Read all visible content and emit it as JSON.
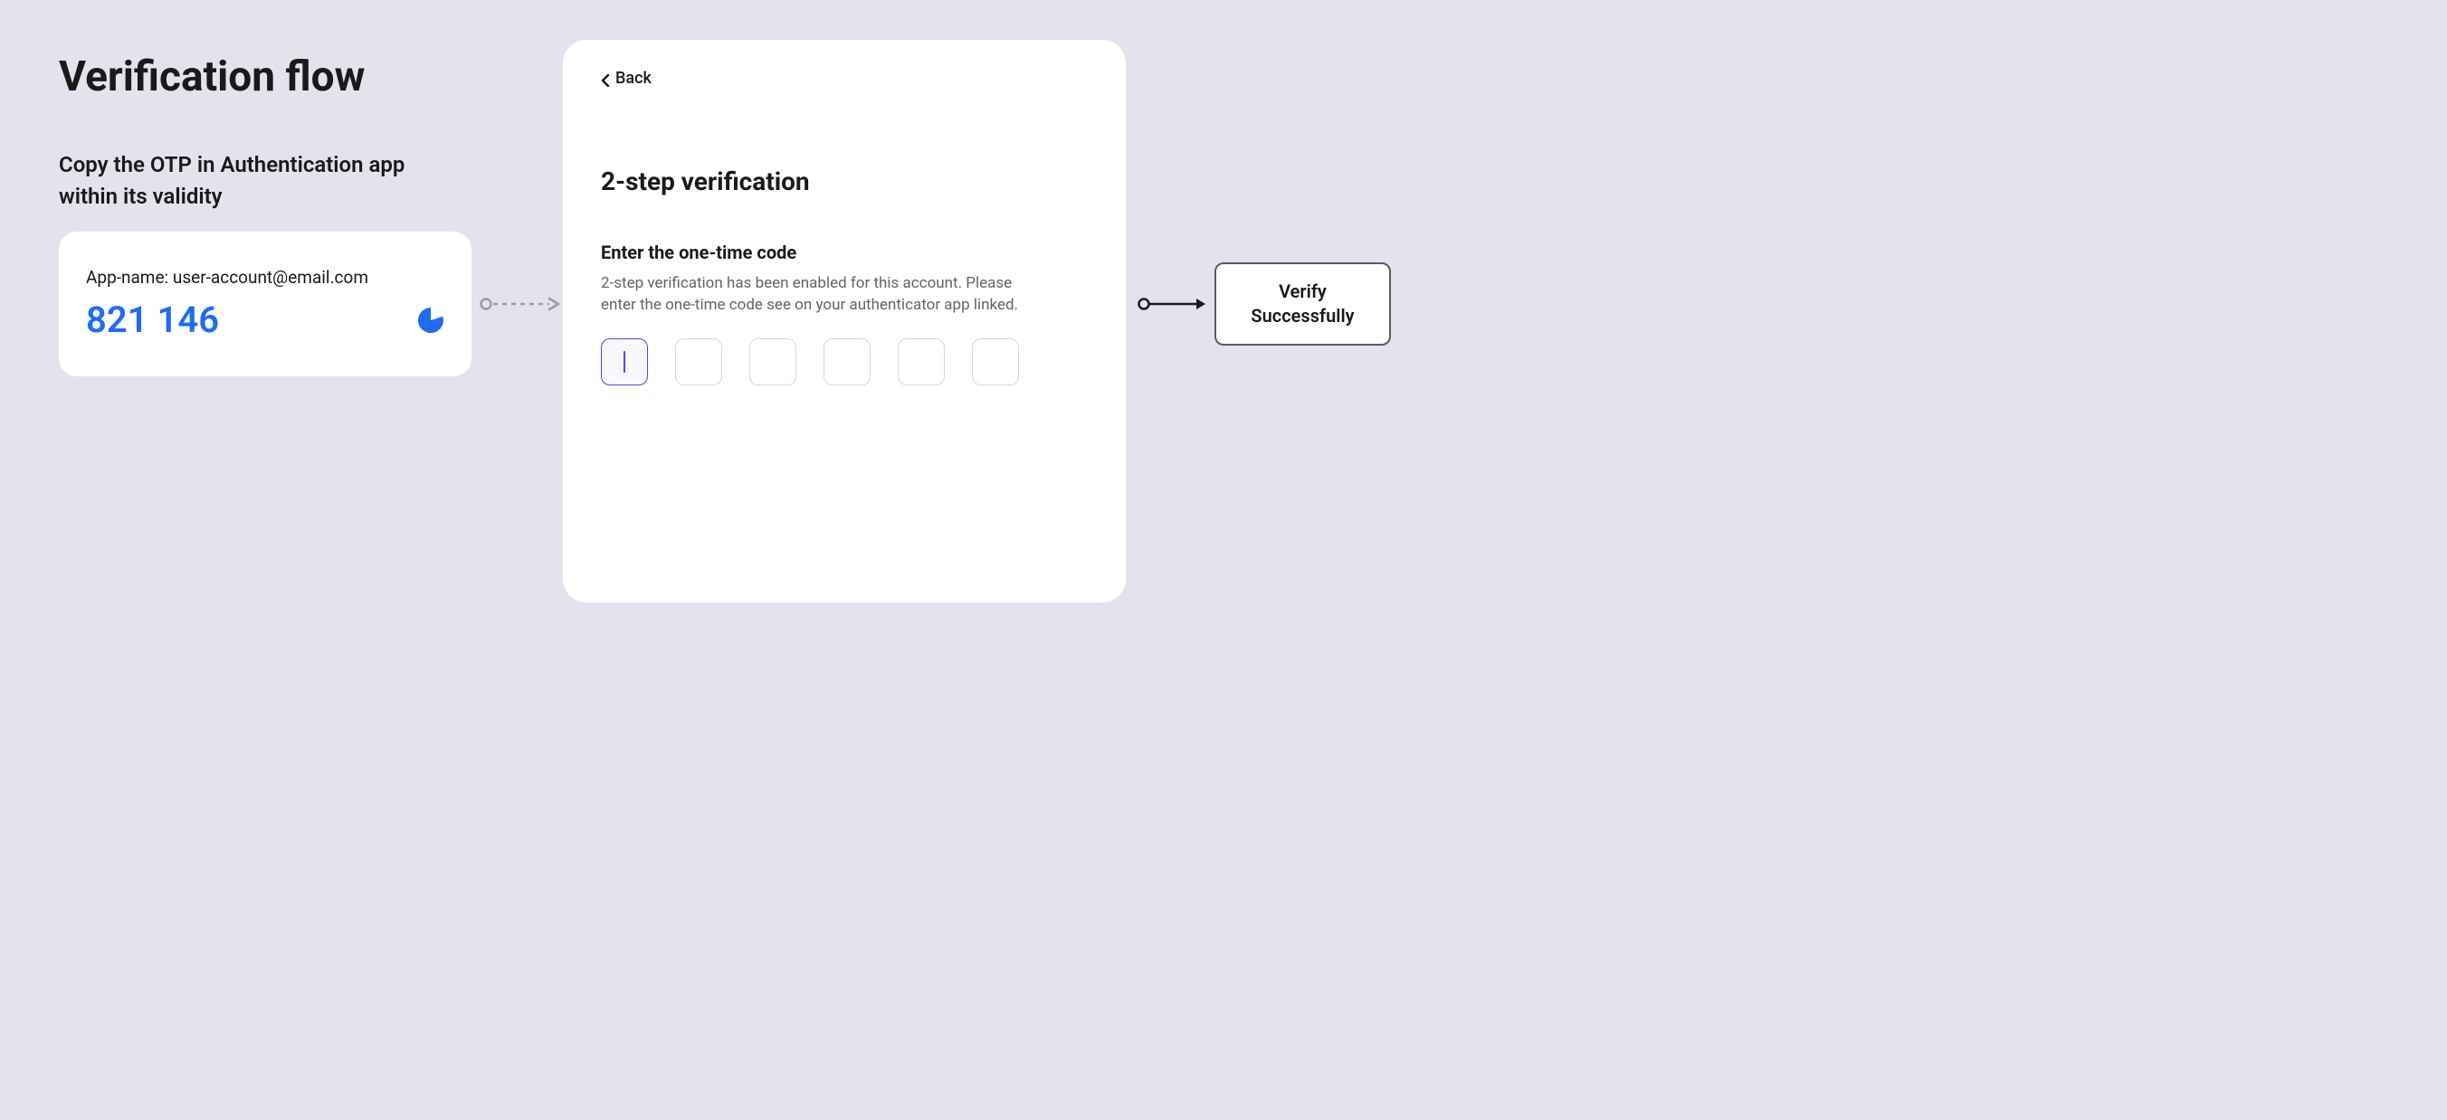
{
  "title": "Verification flow",
  "step_caption": "Copy the OTP in Authentication app within its validity",
  "otp": {
    "account_label": "App-name: user-account@email.com",
    "code": "821 146"
  },
  "card": {
    "back_label": "Back",
    "heading": "2-step verification",
    "subheading": "Enter the one-time code",
    "description": "2-step verification has been enabled for this account. Please enter the one-time code see on your authenticator app linked.",
    "code_length": 6,
    "active_index": 0
  },
  "success_label": "Verify Successfully",
  "colors": {
    "accent_blue": "#1D6CF3",
    "accent_purple": "#5B3DF5",
    "bg": "#E5E2EE",
    "card_bg": "#FFFFFF",
    "text_muted": "#62646B",
    "border_gray": "#D7D7DC",
    "outline_dark": "#5A5B60"
  }
}
